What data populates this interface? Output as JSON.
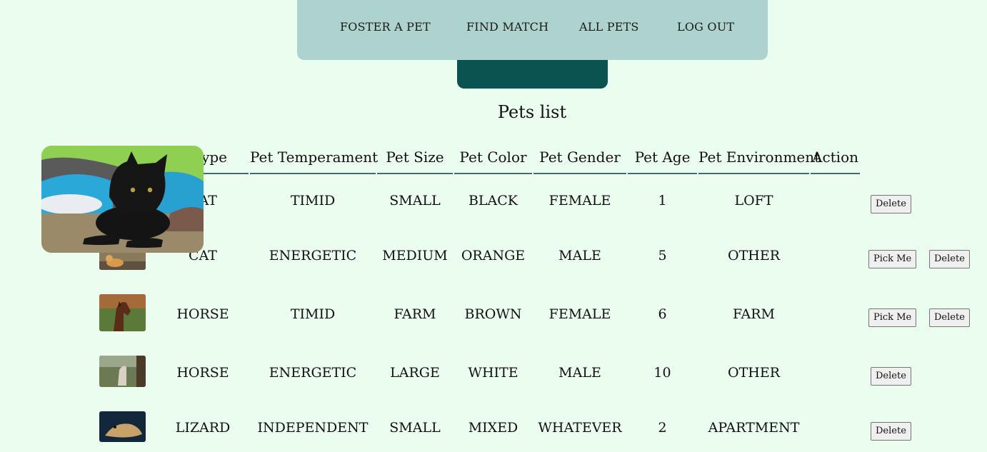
{
  "nav": {
    "items": [
      "FOSTER A PET",
      "FIND MATCH",
      "ALL PETS",
      "LOG OUT"
    ]
  },
  "page": {
    "title": "Pets list"
  },
  "table": {
    "headers": [
      "Pet Type",
      "Pet Temperament",
      "Pet Size",
      "Pet Color",
      "Pet Gender",
      "Pet Age",
      "Pet Environment",
      "Action"
    ],
    "rows": [
      {
        "type": "CAT",
        "temperament": "TIMID",
        "size": "SMALL",
        "color": "BLACK",
        "gender": "FEMALE",
        "age": "1",
        "environment": "LOFT",
        "actions": [
          "Delete"
        ],
        "thumb": "black-cat-photo"
      },
      {
        "type": "CAT",
        "temperament": "ENERGETIC",
        "size": "MEDIUM",
        "color": "ORANGE",
        "gender": "MALE",
        "age": "5",
        "environment": "OTHER",
        "actions": [
          "Pick Me",
          "Delete"
        ],
        "thumb": "orange-cat-photo"
      },
      {
        "type": "HORSE",
        "temperament": "TIMID",
        "size": "FARM",
        "color": "BROWN",
        "gender": "FEMALE",
        "age": "6",
        "environment": "FARM",
        "actions": [
          "Pick Me",
          "Delete"
        ],
        "thumb": "brown-horse-photo"
      },
      {
        "type": "HORSE",
        "temperament": "ENERGETIC",
        "size": "LARGE",
        "color": "WHITE",
        "gender": "MALE",
        "age": "10",
        "environment": "OTHER",
        "actions": [
          "Delete"
        ],
        "thumb": "white-horse-photo"
      },
      {
        "type": "LIZARD",
        "temperament": "INDEPENDENT",
        "size": "SMALL",
        "color": "MIXED",
        "gender": "WHATEVER",
        "age": "2",
        "environment": "APARTMENT",
        "actions": [
          "Delete"
        ],
        "thumb": "lizard-photo"
      }
    ]
  },
  "popup": {
    "image": "black-cat-enlarged-photo"
  },
  "colors": {
    "background": "#ebfdee",
    "navbar": "#aed3cf",
    "dark_bar": "#0b5350",
    "header_border": "#3f6d70"
  }
}
